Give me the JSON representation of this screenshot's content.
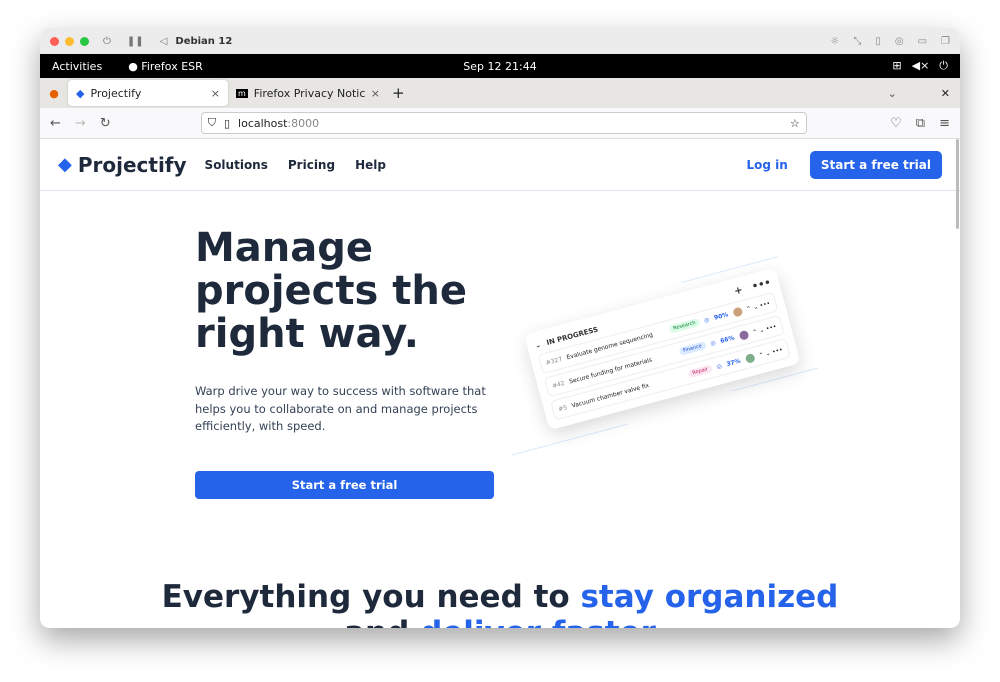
{
  "vm": {
    "title": "Debian 12"
  },
  "gnome": {
    "activities": "Activities",
    "app": "Firefox ESR",
    "clock": "Sep 12  21:44"
  },
  "tabs": [
    {
      "label": "Projectify",
      "close": "×"
    },
    {
      "label": "Firefox Privacy Notice — ",
      "close": "×"
    }
  ],
  "tabs_new": "+",
  "url": {
    "host": "localhost",
    "port": ":8000"
  },
  "site": {
    "brand": "Projectify",
    "menu": [
      "Solutions",
      "Pricing",
      "Help"
    ],
    "login": "Log in",
    "cta": "Start a free trial"
  },
  "hero": {
    "title_lines": [
      "Manage",
      "projects the",
      "right way."
    ],
    "lead": "Warp drive your way to success with software that helps you to collaborate on and manage projects efficiently, with speed.",
    "cta": "Start a free trial"
  },
  "illustration": {
    "section": "IN PROGRESS",
    "rows": [
      {
        "id": "#327",
        "title": "Evaluate genome sequencing",
        "tag": "Research",
        "tag_color": "#dcfce7",
        "progress": "90%"
      },
      {
        "id": "#42",
        "title": "Secure funding for materials",
        "tag": "Finance",
        "tag_color": "#dbeafe",
        "progress": "66%"
      },
      {
        "id": "#5",
        "title": "Vacuum chamber valve fix",
        "tag": "Repair",
        "tag_color": "#fce7f3",
        "progress": "37%"
      }
    ]
  },
  "section2": {
    "lead": "Everything you need to ",
    "highlight": "stay organized",
    "line2_lead": "and ",
    "line2_highlight": "deliver faster"
  }
}
